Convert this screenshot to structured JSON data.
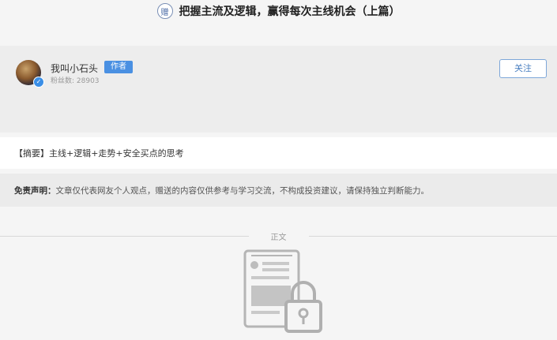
{
  "header": {
    "gift_icon_text": "赠",
    "title": "把握主流及逻辑，赢得每次主线机会（上篇）"
  },
  "author": {
    "name": "我叫小石头",
    "badge": "作者",
    "fans": "粉丝数:   28903",
    "follow_label": "关注",
    "verified_icon": "check-icon"
  },
  "summary": {
    "text": "【摘要】主线+逻辑+走势+安全买点的思考"
  },
  "disclaimer": {
    "label": "免责声明：",
    "text": "文章仅代表网友个人观点，赠送的内容仅供参考与学习交流，不构成投资建议，请保持独立判断能力。"
  },
  "body_divider": {
    "label": "正文"
  },
  "locked_content": {
    "icon": "locked-document-icon"
  }
}
